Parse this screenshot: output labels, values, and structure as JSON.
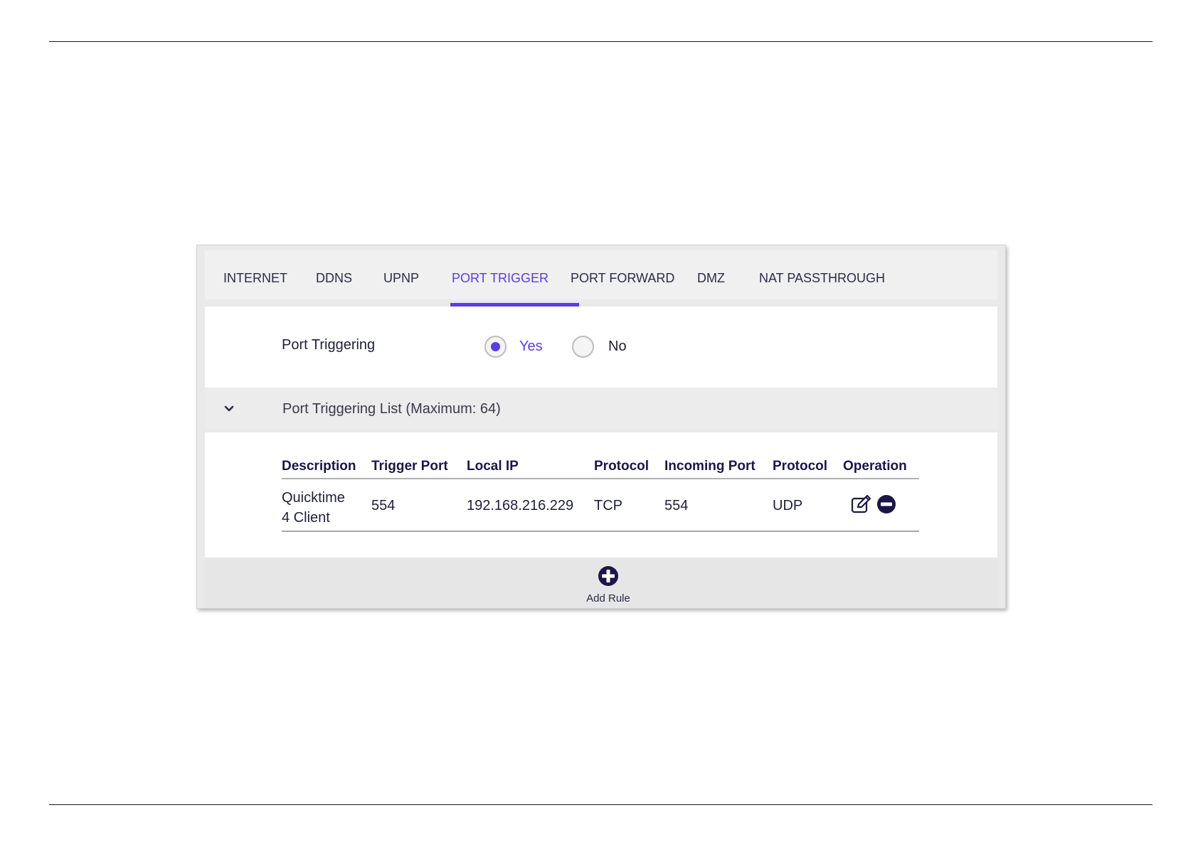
{
  "tabs": [
    {
      "label": "INTERNET",
      "active": false
    },
    {
      "label": "DDNS",
      "active": false
    },
    {
      "label": "UPNP",
      "active": false
    },
    {
      "label": "PORT TRIGGER",
      "active": true
    },
    {
      "label": "PORT FORWARD",
      "active": false
    },
    {
      "label": "DMZ",
      "active": false
    },
    {
      "label": "NAT PASSTHROUGH",
      "active": false
    }
  ],
  "port_triggering": {
    "label": "Port Triggering",
    "options": [
      "Yes",
      "No"
    ],
    "selected": "Yes"
  },
  "list": {
    "title": "Port Triggering List (Maximum: 64)",
    "columns": [
      "Description",
      "Trigger Port",
      "Local IP",
      "Protocol",
      "Incoming Port",
      "Protocol",
      "Operation"
    ],
    "rows": [
      {
        "description_line1": "Quicktime",
        "description_line2": "4 Client",
        "trigger_port": "554",
        "local_ip": "192.168.216.229",
        "trigger_protocol": "TCP",
        "incoming_port": "554",
        "incoming_protocol": "UDP",
        "operations": [
          "edit-icon",
          "remove-icon"
        ]
      }
    ]
  },
  "add_rule": {
    "label": "Add Rule",
    "icon": "plus-circle-icon"
  },
  "colors": {
    "accent": "#5b3ce6",
    "icon_dark": "#1c1648",
    "text": "#1f1f3a"
  }
}
